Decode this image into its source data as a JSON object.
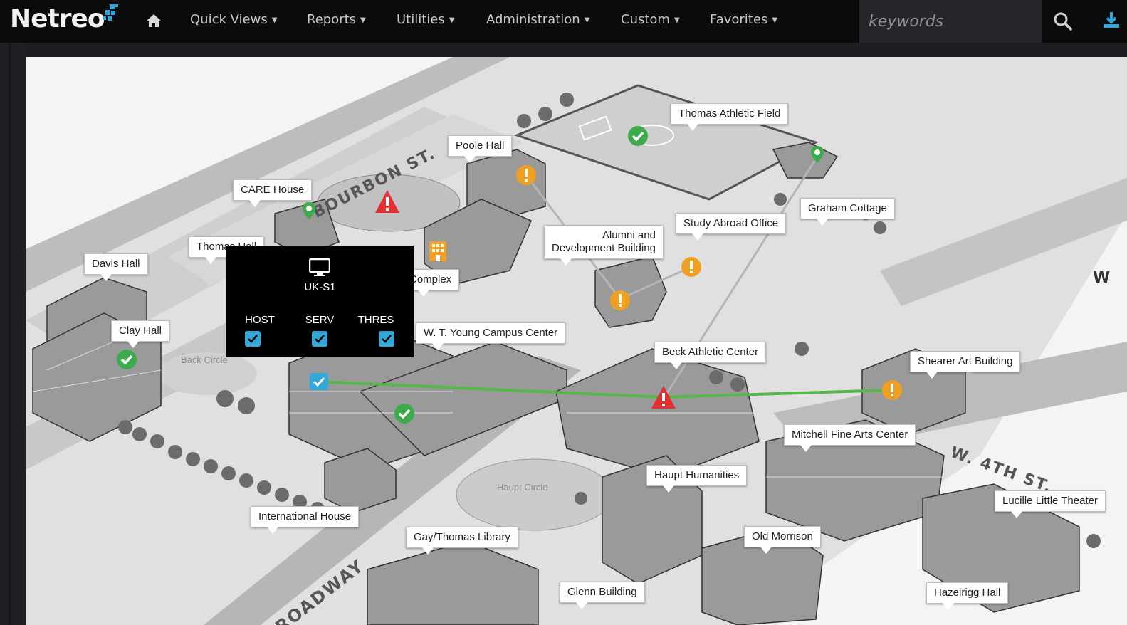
{
  "brand": {
    "name": "Netreo"
  },
  "nav": {
    "items": [
      {
        "label": "Quick Views"
      },
      {
        "label": "Reports"
      },
      {
        "label": "Utilities"
      },
      {
        "label": "Administration"
      },
      {
        "label": "Custom"
      },
      {
        "label": "Favorites"
      }
    ],
    "search_placeholder": "keywords"
  },
  "icons": {
    "home": "home-icon",
    "search": "search-icon",
    "download": "download-icon",
    "monitor": "monitor-icon",
    "ok": "ok-status-icon",
    "warning": "warning-status-icon",
    "critical": "critical-status-icon"
  },
  "colors": {
    "ok": "#3daa4b",
    "warning": "#f0a020",
    "critical": "#e03030",
    "link": "#52b848",
    "checkbox": "#33a7d6"
  },
  "map": {
    "labels": [
      "Thomas Athletic Field",
      "Poole Hall",
      "CARE House",
      "Graham Cottage",
      "Study Abroad Office",
      "Alumni and\nDevelopment Building",
      "Davis Hall",
      "Thomas Hall",
      "Complex",
      "Clay Hall",
      "W. T. Young Campus Center",
      "Beck Athletic Center",
      "Shearer Art Building",
      "Mitchell Fine Arts Center",
      "Haupt Humanities",
      "Lucille Little Theater",
      "International House",
      "Gay/Thomas Library",
      "Old Morrison",
      "Glenn Building",
      "Hazelrigg Hall"
    ],
    "streets": [
      "BOURBON ST.",
      "W. 4TH ST.",
      "BROADWAY"
    ],
    "paths": [
      "Back Circle",
      "Haupt Circle"
    ],
    "partial_right": "W"
  },
  "popup": {
    "device": "UK-S1",
    "columns": [
      {
        "label": "HOST",
        "checked": true
      },
      {
        "label": "SERV",
        "checked": true
      },
      {
        "label": "THRES",
        "checked": true
      }
    ]
  }
}
